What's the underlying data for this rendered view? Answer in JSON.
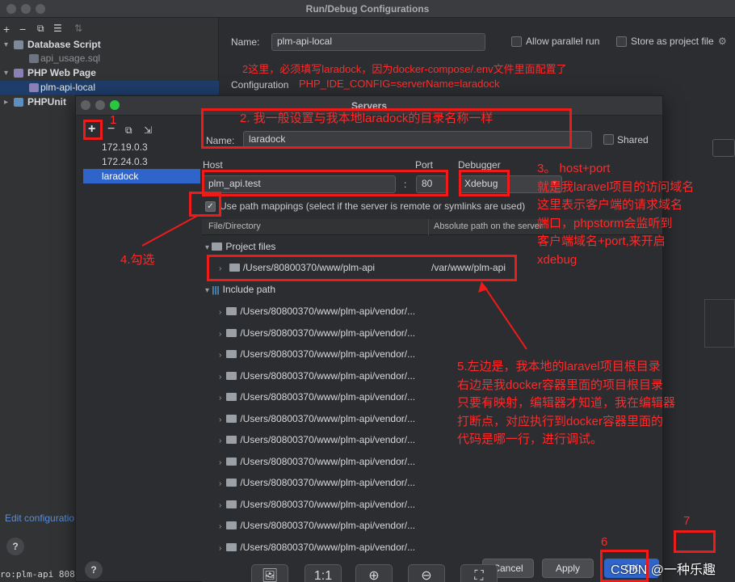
{
  "window": {
    "title": "Run/Debug Configurations"
  },
  "left_panel": {
    "toolbar": [
      "+",
      "−",
      "⧉",
      "☰",
      "⇅"
    ],
    "tree": [
      {
        "label": "Database Script",
        "level": 0,
        "bold": true,
        "expanded": true,
        "icon": "database-script-icon"
      },
      {
        "label": "api_usage.sql",
        "level": 1,
        "bold": false,
        "icon": "sql-file-icon"
      },
      {
        "label": "PHP Web Page",
        "level": 0,
        "bold": true,
        "expanded": true,
        "icon": "php-web-page-icon"
      },
      {
        "label": "plm-api-local",
        "level": 1,
        "bold": false,
        "selected": true,
        "icon": "php-web-page-icon"
      },
      {
        "label": "PHPUnit",
        "level": 0,
        "bold": true,
        "expanded": false,
        "icon": "phpunit-icon"
      }
    ],
    "edit_configs_link": "Edit configuratio",
    "help": "?"
  },
  "run_config": {
    "name_label": "Name:",
    "name_value": "plm-api-local",
    "allow_parallel": "Allow parallel run",
    "store_as_project": "Store as project file",
    "configuration_label": "Configuration"
  },
  "servers_dialog": {
    "title": "Servers",
    "servers": [
      "172.19.0.3",
      "172.24.0.3",
      "laradock"
    ],
    "selected_server": "laradock",
    "name_label": "Name:",
    "name_value": "laradock",
    "shared_label": "Shared",
    "host_label": "Host",
    "host_value": "plm_api.test",
    "port_label": "Port",
    "port_value": "80",
    "debugger_label": "Debugger",
    "debugger_value": "Xdebug",
    "use_path_mappings": "Use path mappings (select if the server is remote or symlinks are used)",
    "col_file_dir": "File/Directory",
    "col_abs_path": "Absolute path on the server",
    "project_files": "Project files",
    "project_local": "/Users/80800370/www/plm-api",
    "project_remote": "/var/www/plm-api",
    "include_path": "Include path",
    "include_items": [
      "/Users/80800370/www/plm-api/vendor/...",
      "/Users/80800370/www/plm-api/vendor/...",
      "/Users/80800370/www/plm-api/vendor/...",
      "/Users/80800370/www/plm-api/vendor/...",
      "/Users/80800370/www/plm-api/vendor/...",
      "/Users/80800370/www/plm-api/vendor/...",
      "/Users/80800370/www/plm-api/vendor/...",
      "/Users/80800370/www/plm-api/vendor/...",
      "/Users/80800370/www/plm-api/vendor/...",
      "/Users/80800370/www/plm-api/vendor/...",
      "/Users/80800370/www/plm-api/vendor/...",
      "/Users/80800370/www/plm-api/vendor/..."
    ],
    "cancel": "Cancel",
    "apply": "Apply",
    "ok": "OK",
    "help": "?",
    "bottom_tools": [
      "🖼",
      "1:1",
      "⊕",
      "⊖",
      "⛶"
    ]
  },
  "annotations": {
    "n1": "1",
    "n2": "2. 我一般设置与我本地laradock的目录名称一样",
    "n2b_line1": "2这里，必须填写laradock，因为docker-compose/.env文件里面配置了",
    "n2b_line2": "PHP_IDE_CONFIG=serverName=laradock",
    "n3_lines": [
      "3。 host+port",
      "就是我laravel项目的访问域名",
      "这里表示客户端的请求域名",
      "端口，phpstorm会监听到",
      "客户端域名+port,来开启",
      "xdebug"
    ],
    "n4": "4.勾选",
    "n5_lines": [
      "5.左边是，我本地的laravel项目根目录",
      "右边是我docker容器里面的项目根目录",
      "只要有映射，编辑器才知道，我在编辑器",
      "打断点，对应执行到docker容器里面的",
      "代码是哪一行，进行调试。"
    ],
    "n6": "6",
    "n7": "7"
  },
  "terminal_line": "ro:plm-api 808",
  "watermark": "CSDN @一种乐趣",
  "colors": {
    "accent": "#2f65ca",
    "annotation": "#ff2a2a"
  }
}
